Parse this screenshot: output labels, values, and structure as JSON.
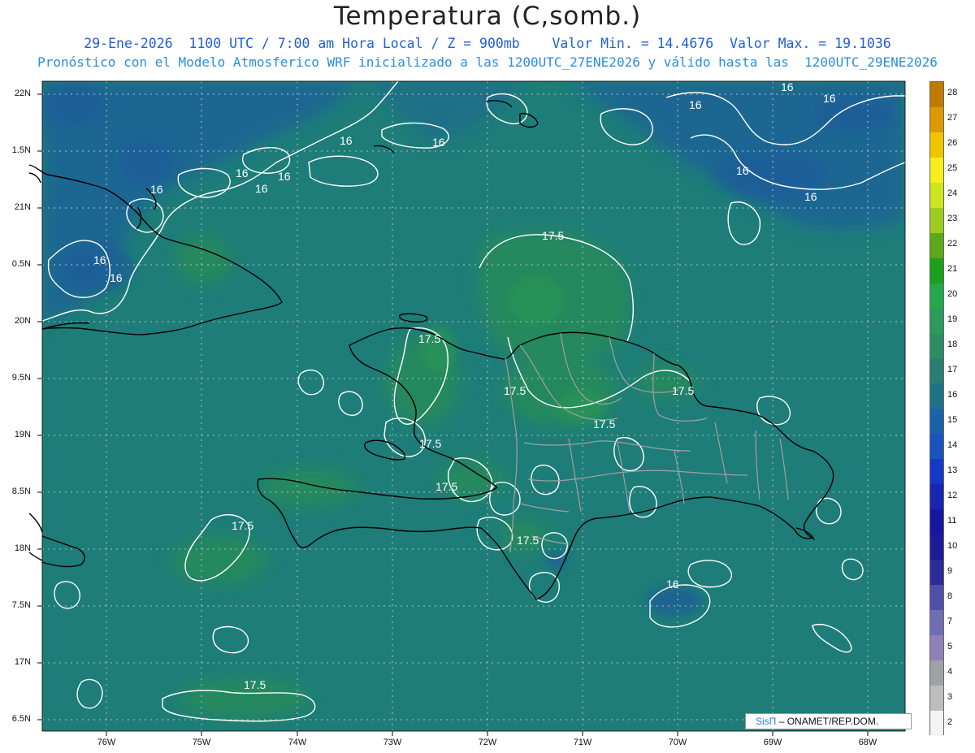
{
  "header": {
    "title": "Temperatura (C,somb.)",
    "line1": "29-Ene-2026  1100 UTC / 7:00 am Hora Local / Z = 900mb    Valor Min. = 14.4676  Valor Max. = 19.1036",
    "line2": "Pronóstico con el Modelo Atmosferico WRF inicializado a las 1200UTC_27ENE2026 y válido hasta las  1200UTC_29ENE2026"
  },
  "axes": {
    "lat_labels": [
      "22N",
      "1.5N",
      "21N",
      "0.5N",
      "20N",
      "9.5N",
      "19N",
      "8.5N",
      "18N",
      "7.5N",
      "17N",
      "6.5N"
    ],
    "lon_labels": [
      "76W",
      "75W",
      "74W",
      "73W",
      "72W",
      "71W",
      "70W",
      "69W",
      "68W"
    ]
  },
  "contour_labels": {
    "upper": [
      "16",
      "16",
      "16",
      "16",
      "16",
      "16",
      "16",
      "16",
      "16",
      "16",
      "16",
      "16",
      "16"
    ],
    "mid": [
      "17.5",
      "17.5",
      "17.5",
      "17.5",
      "17.5",
      "17.5",
      "17.5",
      "17.5",
      "17.5",
      "17.5"
    ],
    "south": [
      "16"
    ]
  },
  "colorbar": {
    "labels": [
      "28",
      "27",
      "26",
      "25",
      "24",
      "23",
      "22",
      "21",
      "20",
      "19",
      "18",
      "17",
      "16",
      "15",
      "14",
      "13",
      "12",
      "11",
      "10",
      "9",
      "8",
      "7",
      "5",
      "4",
      "3",
      "2"
    ],
    "colors": [
      "#c07a00",
      "#dc9a00",
      "#f2c400",
      "#f5ee1a",
      "#cde620",
      "#9ccc1e",
      "#5ea818",
      "#1c9f1c",
      "#23a94a",
      "#2c9a5a",
      "#2e8e62",
      "#2a7f72",
      "#1d7488",
      "#1a63a8",
      "#1a53be",
      "#1538c8",
      "#1826b0",
      "#1616a0",
      "#1c1c98",
      "#2b2b9a",
      "#5050a8",
      "#6e6eb4",
      "#8f80b8",
      "#a0a0a8",
      "#bdbdbd",
      "#f4f4f4"
    ]
  },
  "credit": {
    "brand": "SisΠ",
    "text": "– ONAMET/REP.DOM."
  }
}
